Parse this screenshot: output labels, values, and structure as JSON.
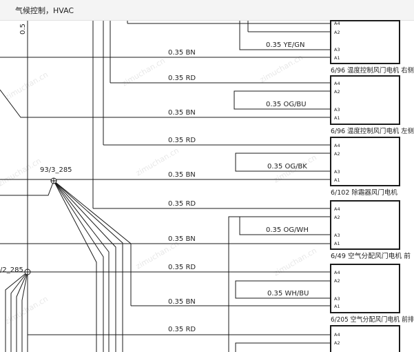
{
  "header": {
    "title": "气候控制，HVAC"
  },
  "wires": [
    {
      "id": "w1",
      "label": "0.35 YE/GN"
    },
    {
      "id": "w2",
      "label": "0.35 BN"
    },
    {
      "id": "w3",
      "label": "0.35 RD"
    },
    {
      "id": "w4",
      "label": "0.35 OG/BU"
    },
    {
      "id": "w5",
      "label": "0.35 BN"
    },
    {
      "id": "w6",
      "label": "0.35 RD"
    },
    {
      "id": "w7",
      "label": "0.35 OG/BK"
    },
    {
      "id": "w8",
      "label": "0.35 BN"
    },
    {
      "id": "w9",
      "label": "0.35 RD"
    },
    {
      "id": "w10",
      "label": "0.35 OG/WH"
    },
    {
      "id": "w11",
      "label": "0.35 BN"
    },
    {
      "id": "w12",
      "label": "0.35 RD"
    },
    {
      "id": "w13",
      "label": "0.35 WH/BU"
    },
    {
      "id": "w14",
      "label": "0.35 BN"
    },
    {
      "id": "w15",
      "label": "0.35 RD"
    }
  ],
  "components": [
    {
      "id": "c1",
      "label": "6/96 温度控制风门电机 右侧"
    },
    {
      "id": "c2",
      "label": "6/96 温度控制风门电机 左侧"
    },
    {
      "id": "c3",
      "label": "6/102 除霜器风门电机"
    },
    {
      "id": "c4",
      "label": "6/49 空气分配风门电机 前"
    },
    {
      "id": "c5",
      "label": "6/205 空气分配风门电机 前排"
    }
  ],
  "pins": {
    "a4": "A4",
    "a2": "A2",
    "a3": "A3",
    "a1": "A1"
  },
  "splices": {
    "s1": "93/3_285",
    "s2": "/2_285"
  },
  "edge_label": "0.5",
  "watermark": "zimuchan.cn"
}
